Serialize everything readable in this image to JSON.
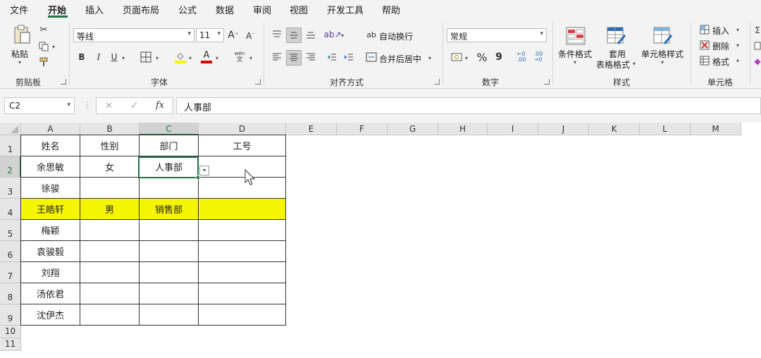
{
  "menu": {
    "tabs": [
      "文件",
      "开始",
      "插入",
      "页面布局",
      "公式",
      "数据",
      "审阅",
      "视图",
      "开发工具",
      "帮助"
    ],
    "active": "开始"
  },
  "ribbon": {
    "clipboard": {
      "paste": "粘贴",
      "label": "剪贴板"
    },
    "font": {
      "name": "等线",
      "size": "11",
      "grow": "A",
      "shrink": "A",
      "bold": "B",
      "italic": "I",
      "underline": "U",
      "fill_glyph": "◇",
      "color_glyph": "A",
      "phonetic_top": "wén",
      "phonetic_bottom": "文",
      "label": "字体"
    },
    "alignment": {
      "wrap": "自动换行",
      "merge": "合并后居中",
      "wrap_icon": "ab",
      "label": "对齐方式"
    },
    "number": {
      "format": "常规",
      "percent": "%",
      "comma": "9",
      "label": "数字"
    },
    "styles": {
      "conditional": "条件格式",
      "table_line1": "套用",
      "table_line2": "表格格式",
      "cell_styles": "单元格样式",
      "label": "样式"
    },
    "cells": {
      "insert": "插入",
      "delete": "删除",
      "format": "格式",
      "label": "单元格"
    }
  },
  "formula_bar": {
    "name_box": "C2",
    "fx": "fx",
    "cancel": "✕",
    "confirm": "✓",
    "value": "人事部"
  },
  "sheet": {
    "columns": [
      "A",
      "B",
      "C",
      "D",
      "E",
      "F",
      "G",
      "H",
      "I",
      "J",
      "K",
      "L",
      "M"
    ],
    "selected_column": "C",
    "selected_row": "2",
    "rows": [
      {
        "num": "1",
        "cells": [
          "姓名",
          "性别",
          "部门",
          "工号"
        ],
        "highlight": false
      },
      {
        "num": "2",
        "cells": [
          "余思敏",
          "女",
          "人事部",
          ""
        ],
        "highlight": false
      },
      {
        "num": "3",
        "cells": [
          "徐骏",
          "",
          "",
          ""
        ],
        "highlight": false
      },
      {
        "num": "4",
        "cells": [
          "王皓轩",
          "男",
          "销售部",
          ""
        ],
        "highlight": true
      },
      {
        "num": "5",
        "cells": [
          "梅颖",
          "",
          "",
          ""
        ],
        "highlight": false
      },
      {
        "num": "6",
        "cells": [
          "袁骏毅",
          "",
          "",
          ""
        ],
        "highlight": false
      },
      {
        "num": "7",
        "cells": [
          "刘翔",
          "",
          "",
          ""
        ],
        "highlight": false
      },
      {
        "num": "8",
        "cells": [
          "汤依君",
          "",
          "",
          ""
        ],
        "highlight": false
      },
      {
        "num": "9",
        "cells": [
          "沈伊杰",
          "",
          "",
          ""
        ],
        "highlight": false
      },
      {
        "num": "10",
        "cells": [],
        "highlight": false
      },
      {
        "num": "11",
        "cells": [],
        "highlight": false
      }
    ],
    "highlight_color": "#f5f500",
    "accent_color": "#217346"
  }
}
